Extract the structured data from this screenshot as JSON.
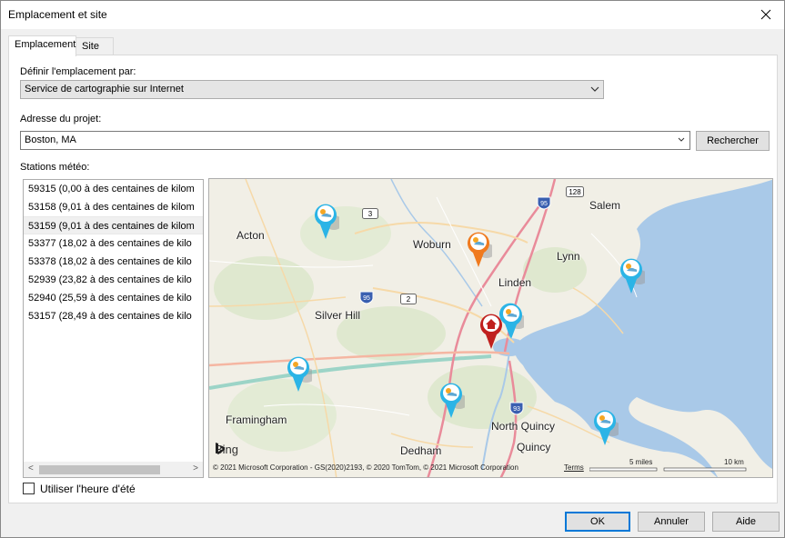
{
  "window": {
    "title": "Emplacement et site"
  },
  "tabs": [
    {
      "label": "Emplacement"
    },
    {
      "label": "Site"
    }
  ],
  "location": {
    "define_label": "Définir l'emplacement par:",
    "define_value": "Service de cartographie sur Internet",
    "address_label": "Adresse du projet:",
    "address_value": "Boston, MA",
    "search_label": "Rechercher"
  },
  "stations": {
    "label": "Stations météo:",
    "items": [
      {
        "text": "59315 (0,00 à des centaines de kilom"
      },
      {
        "text": "53158 (9,01 à des centaines de kilom"
      },
      {
        "text": "53159 (9,01 à des centaines de kilom"
      },
      {
        "text": "53377 (18,02 à des centaines de kilo"
      },
      {
        "text": "53378 (18,02 à des centaines de kilo"
      },
      {
        "text": "52939 (23,82 à des centaines de kilo"
      },
      {
        "text": "52940 (25,59 à des centaines de kilo"
      },
      {
        "text": "53157 (28,49 à des centaines de kilo"
      }
    ],
    "selected_index": 2
  },
  "map": {
    "cities": {
      "salem": "Salem",
      "acton": "Acton",
      "woburn": "Woburn",
      "lynn": "Lynn",
      "linden": "Linden",
      "silver_hill": "Silver Hill",
      "framingham": "Framingham",
      "north_quincy": "North Quincy",
      "quincy": "Quincy",
      "dedham": "Dedham"
    },
    "shields": {
      "r128": "128",
      "r3": "3",
      "r95a": "95",
      "r2": "2",
      "r95b": "95",
      "r93": "93"
    },
    "bing": "Bing",
    "copyright": "© 2021 Microsoft Corporation - GS(2020)2193, © 2020 TomTom, © 2021 Microsoft Corporation",
    "terms": "Terms",
    "scale_miles": "5 miles",
    "scale_km": "10 km",
    "colors": {
      "water": "#a9c9e8",
      "land": "#f1efe6",
      "pin_blue": "#2bb4e6",
      "pin_orange": "#f07a1e",
      "pin_red": "#c0201e"
    }
  },
  "dst": {
    "label": "Utiliser l'heure d'été",
    "checked": false
  },
  "buttons": {
    "ok": "OK",
    "cancel": "Annuler",
    "help": "Aide"
  }
}
